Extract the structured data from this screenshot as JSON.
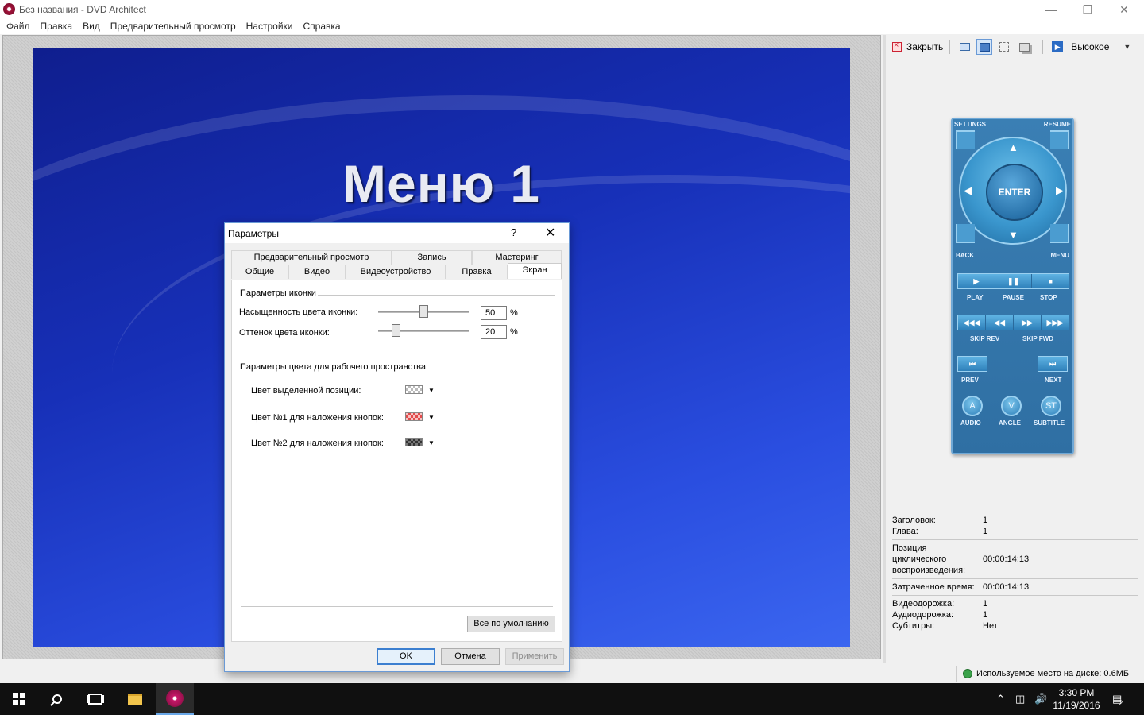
{
  "window": {
    "title": "Без названия - DVD Architect"
  },
  "menubar": {
    "items": [
      "Файл",
      "Правка",
      "Вид",
      "Предварительный просмотр",
      "Настройки",
      "Справка"
    ]
  },
  "canvas": {
    "title": "Меню 1"
  },
  "preview_toolbar": {
    "close_label": "Закрыть",
    "quality_value": "Высокое"
  },
  "remote": {
    "settings": "SETTINGS",
    "resume": "RESUME",
    "enter": "ENTER",
    "back": "BACK",
    "menu": "MENU",
    "play": "PLAY",
    "pause": "PAUSE",
    "stop": "STOP",
    "skip_rev": "SKIP REV",
    "skip_fwd": "SKIP FWD",
    "prev": "PREV",
    "next": "NEXT",
    "audio": "AUDIO",
    "angle": "ANGLE",
    "subtitle": "SUBTITLE",
    "audio_glyph": "A",
    "angle_glyph": "V",
    "subtitle_glyph": "ST"
  },
  "info": {
    "title_key": "Заголовок:",
    "title_val": "1",
    "chapter_key": "Глава:",
    "chapter_val": "1",
    "loop_key_1": "Позиция",
    "loop_key_2": "циклического",
    "loop_key_3": "воспроизведения:",
    "loop_val": "00:00:14:13",
    "elapsed_key": "Затраченное время:",
    "elapsed_val": "00:00:14:13",
    "video_key": "Видеодорожка:",
    "video_val": "1",
    "audio_key": "Аудиодорожка:",
    "audio_val": "1",
    "subs_key": "Субтитры:",
    "subs_val": "Нет"
  },
  "status": {
    "disk": "Используемое место на диске: 0.6МБ"
  },
  "dialog": {
    "title": "Параметры",
    "help": "?",
    "tabs_row1": [
      "Предварительный просмотр",
      "Запись",
      "Мастеринг"
    ],
    "tabs_row2": [
      "Общие",
      "Видео",
      "Видеоустройство",
      "Правка",
      "Экран"
    ],
    "group1": "Параметры иконки",
    "saturation_label": "Насыщенность цвета иконки:",
    "saturation_value": "50",
    "saturation_level": 0.5,
    "tint_label": "Оттенок цвета иконки:",
    "tint_value": "20",
    "tint_level": 0.2,
    "percent": "%",
    "group2": "Параметры цвета для рабочего пространства",
    "highlight_label": "Цвет выделенной позиции:",
    "overlay1_label": "Цвет №1 для наложения кнопок:",
    "overlay2_label": "Цвет №2 для наложения кнопок:",
    "defaults_button": "Все по умолчанию",
    "ok": "OK",
    "cancel": "Отмена",
    "apply": "Применить"
  },
  "taskbar": {
    "time": "3:30 PM",
    "date": "11/19/2016",
    "notifications": "2"
  }
}
